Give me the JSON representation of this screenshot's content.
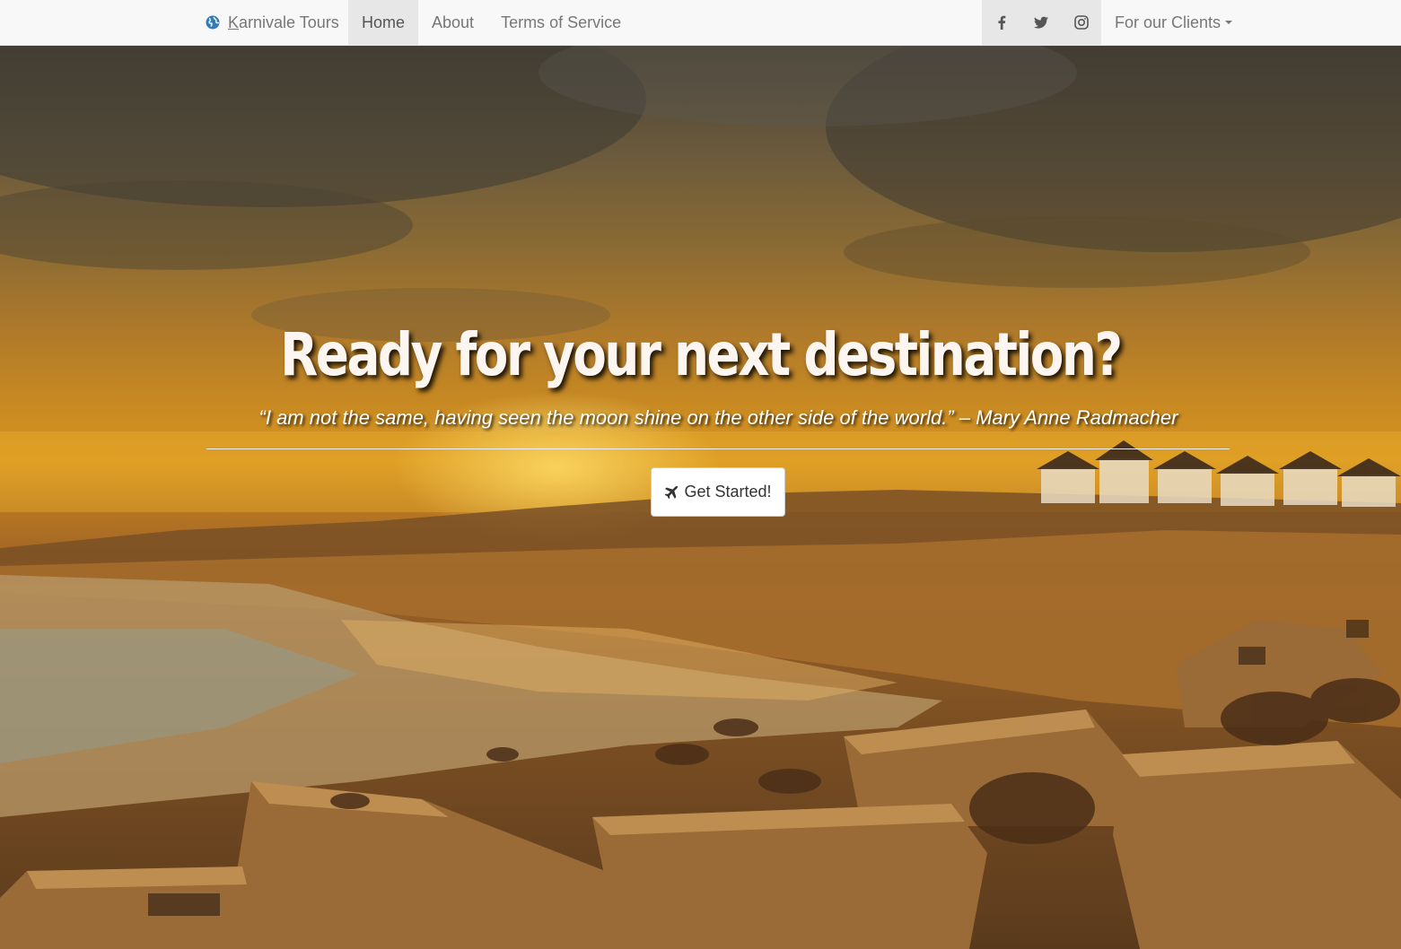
{
  "navbar": {
    "brand": "Karnivale Tours",
    "brand_icon": "globe-icon",
    "links": [
      {
        "label": "Home",
        "active": true
      },
      {
        "label": "About",
        "active": false
      },
      {
        "label": "Terms of Service",
        "active": false
      }
    ],
    "social": [
      {
        "icon": "facebook-icon"
      },
      {
        "icon": "twitter-icon"
      },
      {
        "icon": "instagram-icon"
      }
    ],
    "clients_label": "For our Clients",
    "colors": {
      "bar": "#f8f8f8",
      "active": "#e7e7e7",
      "text": "#777777",
      "brand_icon": "#337ab7"
    }
  },
  "hero": {
    "headline": "Ready for your next destination?",
    "quote": "“I am not the same, having seen the moon shine on the other side of the world.” – Mary Anne Radmacher",
    "button_label": "Get Started!",
    "button_icon": "plane-icon"
  }
}
